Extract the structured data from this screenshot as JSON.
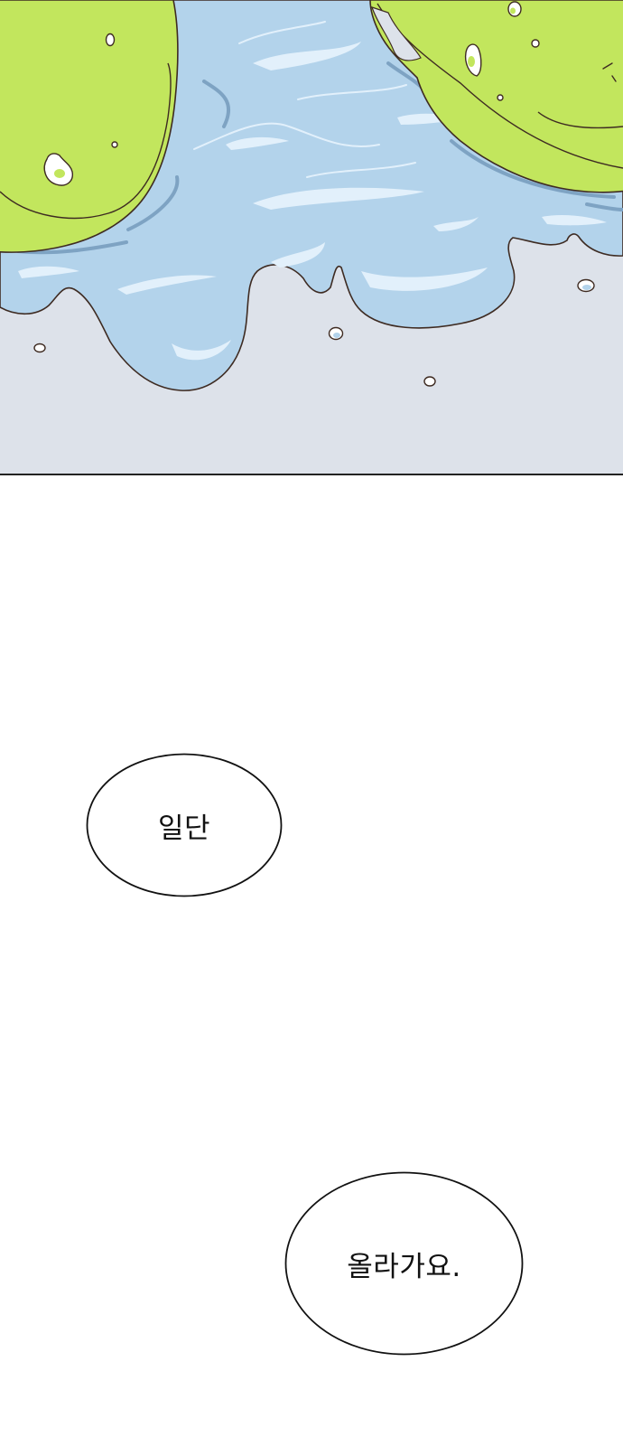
{
  "panel": {
    "scene": "green-shapes-melting-into-water-puddle",
    "colors": {
      "floor": "#dde2ea",
      "water": "#b3d3eb",
      "water_light": "#e2f0fb",
      "water_dark": "#7ea3c3",
      "slime": "#c2e65d",
      "outline": "#3e2b22",
      "frame": "#222222"
    }
  },
  "speech_bubbles": [
    {
      "text": "일단"
    },
    {
      "text": "올라가요."
    }
  ]
}
